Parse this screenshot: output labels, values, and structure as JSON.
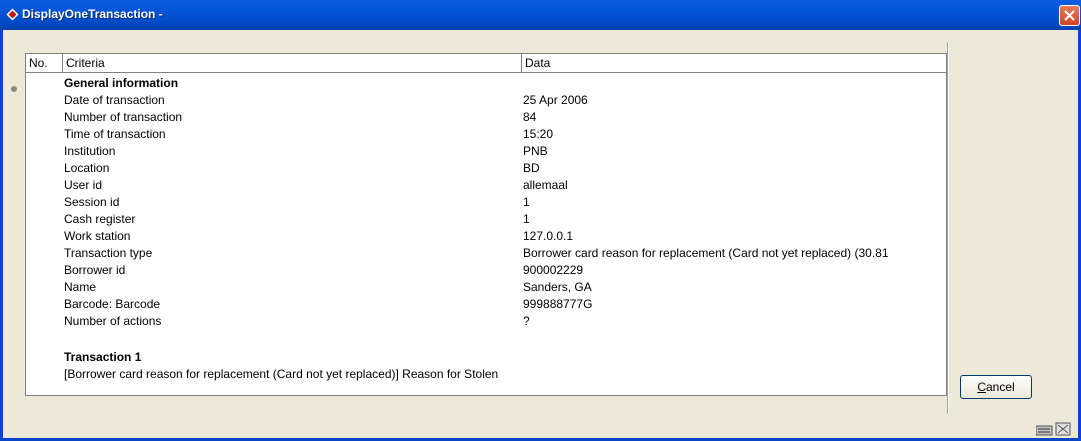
{
  "window": {
    "title": "DisplayOneTransaction -"
  },
  "grid": {
    "columns": [
      "No.",
      "Criteria",
      "Data"
    ],
    "section_general": "General information",
    "rows": [
      {
        "criteria": "Date of transaction",
        "data": "25 Apr 2006"
      },
      {
        "criteria": "Number of transaction",
        "data": "84"
      },
      {
        "criteria": "Time of transaction",
        "data": "15:20"
      },
      {
        "criteria": "Institution",
        "data": "PNB"
      },
      {
        "criteria": "Location",
        "data": "BD"
      },
      {
        "criteria": "User id",
        "data": "allemaal"
      },
      {
        "criteria": "Session id",
        "data": "1"
      },
      {
        "criteria": "Cash register",
        "data": "1"
      },
      {
        "criteria": "Work station",
        "data": "127.0.0.1"
      },
      {
        "criteria": "Transaction type",
        "data": "Borrower card reason for replacement (Card not yet replaced) (30.81"
      },
      {
        "criteria": "Borrower id",
        "data": "900002229"
      },
      {
        "criteria": "Name",
        "data": "Sanders, GA"
      },
      {
        "criteria": "Barcode: Barcode",
        "data": "999888777G"
      },
      {
        "criteria": "Number of actions",
        "data": "?"
      }
    ],
    "section_transaction": "Transaction 1",
    "transaction_text": "[Borrower card reason for replacement (Card not yet replaced)] Reason for Stolen"
  },
  "buttons": {
    "cancel_prefix": "",
    "cancel_accel": "C",
    "cancel_rest": "ancel"
  },
  "colors": {
    "titlebar": "#0354d6",
    "close": "#d4431f",
    "background": "#ece9d8"
  },
  "icons": {
    "title": "app-diamond-icon",
    "close": "close-icon",
    "status": "keyboard-icon"
  }
}
